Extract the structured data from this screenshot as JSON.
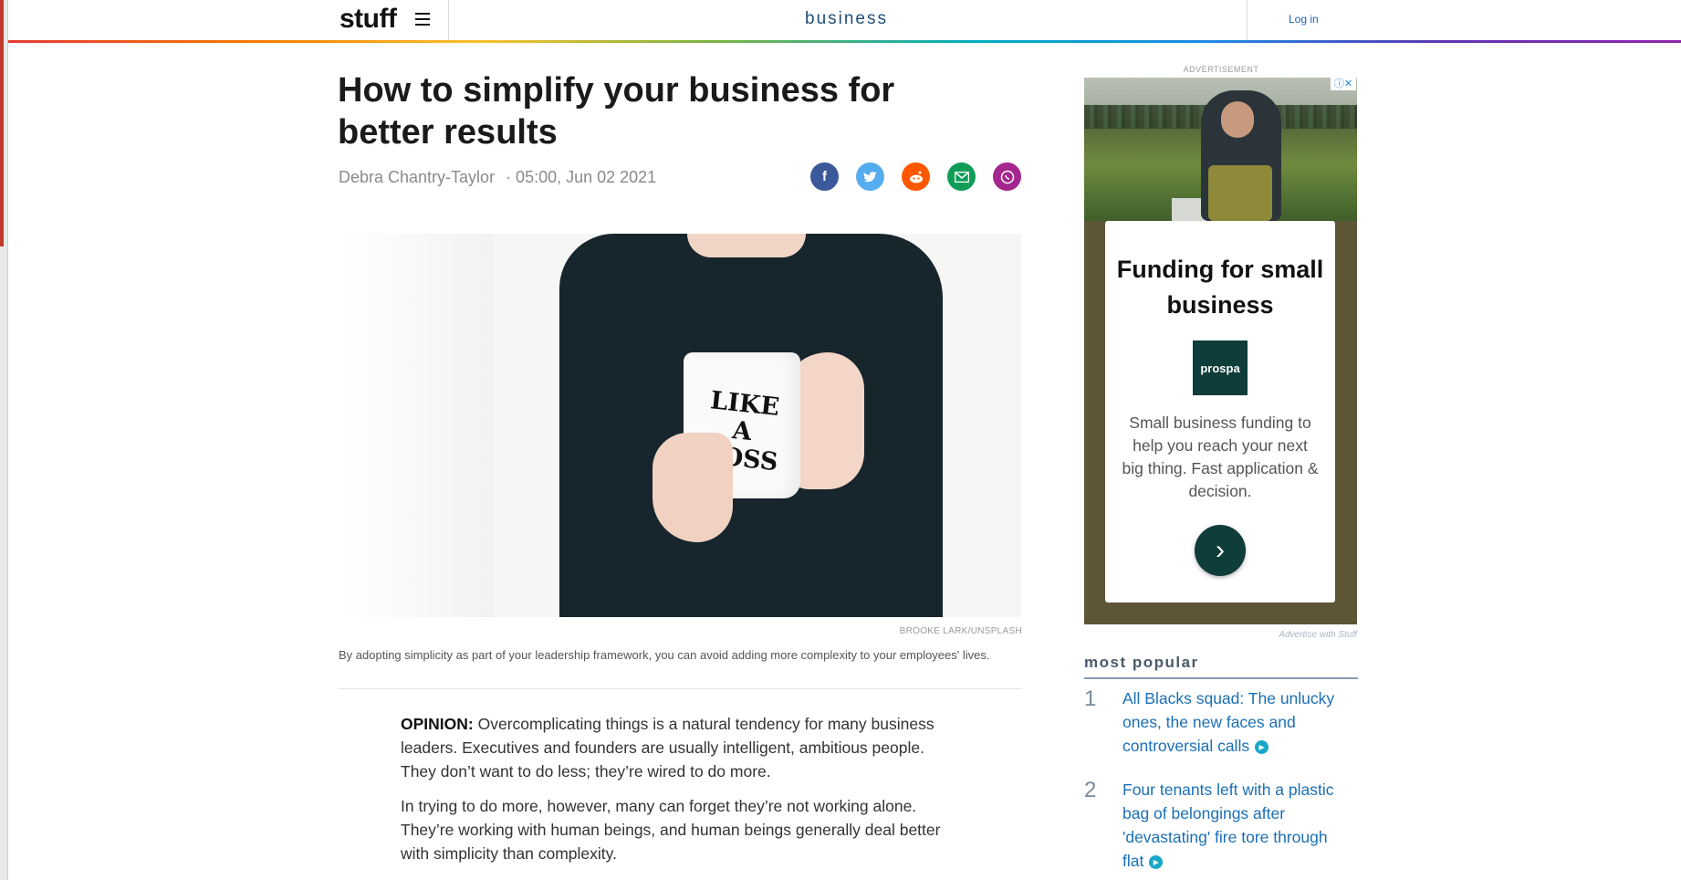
{
  "header": {
    "logo": "stuff",
    "section": "business",
    "login_label": "Log in"
  },
  "article": {
    "title": "How to simplify your business for better results",
    "author": "Debra Chantry-Taylor",
    "date": "· 05:00, Jun 02 2021",
    "share_icons": [
      "facebook-icon",
      "twitter-icon",
      "reddit-icon",
      "email-icon",
      "whatsapp-icon"
    ],
    "share_colors": [
      "#3b5998",
      "#55acee",
      "#ff5700",
      "#0f9d58",
      "#a4268e"
    ],
    "image_mug_text": "LIKE\nA\nBOSS",
    "image_credit": "BROOKE LARK/UNSPLASH",
    "caption": "By adopting simplicity as part of your leadership framework, you can avoid adding more complexity to your employees' lives.",
    "opinion_label": "OPINION:",
    "paragraph1": "Overcomplicating things is a natural tendency for many business leaders. Executives and founders are usually intelligent, ambitious people. They don’t want to do less; they’re wired to do more.",
    "paragraph2": "In trying to do more, however, many can forget they’re not working alone. They’re working with human beings, and human beings generally deal better with simplicity than complexity."
  },
  "ad": {
    "label": "ADVERTISEMENT",
    "headline": "Funding for small business",
    "brand": "prospa",
    "description": "Small business funding to help you reach your next big thing. Fast application & decision.",
    "advertise_link": "Advertise with Stuff"
  },
  "most_popular": {
    "title": "most popular",
    "items": [
      {
        "rank": "1",
        "title": "All Blacks squad: The unlucky ones, the new faces and controversial calls"
      },
      {
        "rank": "2",
        "title": "Four tenants left with a plastic bag of belongings after 'devastating' fire tore through flat"
      }
    ]
  },
  "colors": {
    "accent_link": "#1b6fb5",
    "section_blue": "#1f4e79",
    "ad_brand": "#0f3d3a"
  }
}
